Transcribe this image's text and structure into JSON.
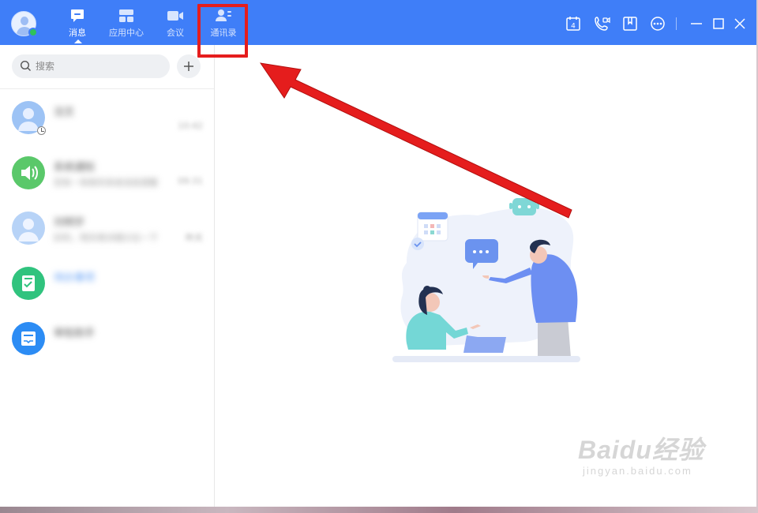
{
  "titlebar": {
    "tabs": [
      {
        "label": "消息",
        "icon": "chat-icon",
        "active": true
      },
      {
        "label": "应用中心",
        "icon": "apps-icon",
        "active": false
      },
      {
        "label": "会议",
        "icon": "video-icon",
        "active": false
      },
      {
        "label": "通讯录",
        "icon": "contacts-icon",
        "active": false
      }
    ],
    "calendar_day": "4",
    "right_icons": [
      "calendar-icon",
      "phone-video-icon",
      "bookmark-icon",
      "more-icon",
      "minimize-icon",
      "maximize-icon",
      "close-icon"
    ],
    "user_status": "online"
  },
  "sidebar": {
    "search": {
      "placeholder": "搜索",
      "value": ""
    },
    "conversations": [
      {
        "name": "沈文",
        "preview": "",
        "time": "10:42",
        "avatar": "user-avatar",
        "color": "#9dc3f5"
      },
      {
        "name": "系统通知",
        "preview": "您有一条新的系统消息提醒",
        "time": "09:31",
        "avatar": "speaker-icon",
        "color": "#5ac86a"
      },
      {
        "name": "刘明宇",
        "preview": "好的，明天再详细讨论一下",
        "time": "昨天",
        "avatar": "user-avatar",
        "color": "#b7d3f7"
      },
      {
        "name": "待办事项",
        "preview": "",
        "time": "",
        "avatar": "todo-icon",
        "color": "#30c37e"
      },
      {
        "name": "审批助手",
        "preview": "",
        "time": "",
        "avatar": "inbox-icon",
        "color": "#2c8cf4"
      }
    ]
  },
  "annotation": {
    "highlight_target": "通讯录",
    "color": "#e51d1d"
  },
  "watermark": {
    "brand": "Baidu经验",
    "url": "jingyan.baidu.com"
  },
  "colors": {
    "primary": "#3f7ef8",
    "online": "#2fc25b"
  }
}
